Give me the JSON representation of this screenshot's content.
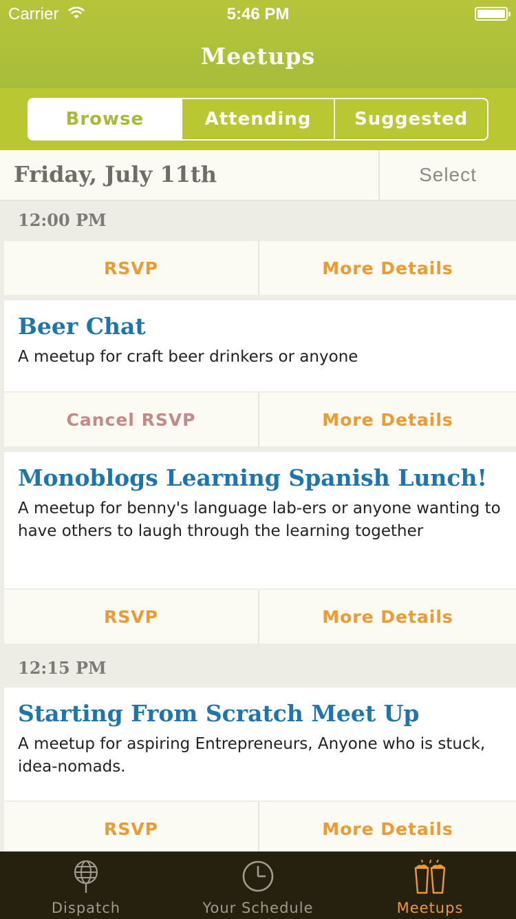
{
  "status_bar": {
    "carrier": "Carrier",
    "time": "5:46 PM"
  },
  "nav": {
    "title": "Meetups"
  },
  "segments": [
    {
      "label": "Browse",
      "active": true
    },
    {
      "label": "Attending",
      "active": false
    },
    {
      "label": "Suggested",
      "active": false
    }
  ],
  "date_row": {
    "date": "Friday, July 11th",
    "select_label": "Select"
  },
  "sections": [
    {
      "time": "12:00 PM"
    },
    {
      "time": "12:15 PM"
    }
  ],
  "actions": {
    "rsvp": "RSVP",
    "cancel_rsvp": "Cancel RSVP",
    "more_details": "More Details"
  },
  "meetups": [
    {
      "title": "Beer Chat",
      "description": "A meetup for craft beer drinkers or anyone",
      "rsvp_label": "Cancel RSVP"
    },
    {
      "title": "Monoblogs Learning Spanish Lunch!",
      "description": "A meetup for benny's language lab-ers or anyone wanting to have others to laugh through the learning together",
      "rsvp_label": "RSVP"
    },
    {
      "title": "Starting From Scratch Meet Up",
      "description": "A meetup for aspiring Entrepreneurs, Anyone who is stuck, idea-nomads.",
      "rsvp_label": "RSVP"
    }
  ],
  "tabbar": [
    {
      "label": "Dispatch",
      "icon": "globe-icon",
      "active": false
    },
    {
      "label": "Your Schedule",
      "icon": "clock-icon",
      "active": false
    },
    {
      "label": "Meetups",
      "icon": "beer-glasses-icon",
      "active": true
    }
  ],
  "colors": {
    "header_green": "#b6c43a",
    "accent_orange": "#ee9a32",
    "title_blue": "#1e74ac",
    "cancel_rose": "#c28b85",
    "tabbar_dark": "#26200f"
  }
}
